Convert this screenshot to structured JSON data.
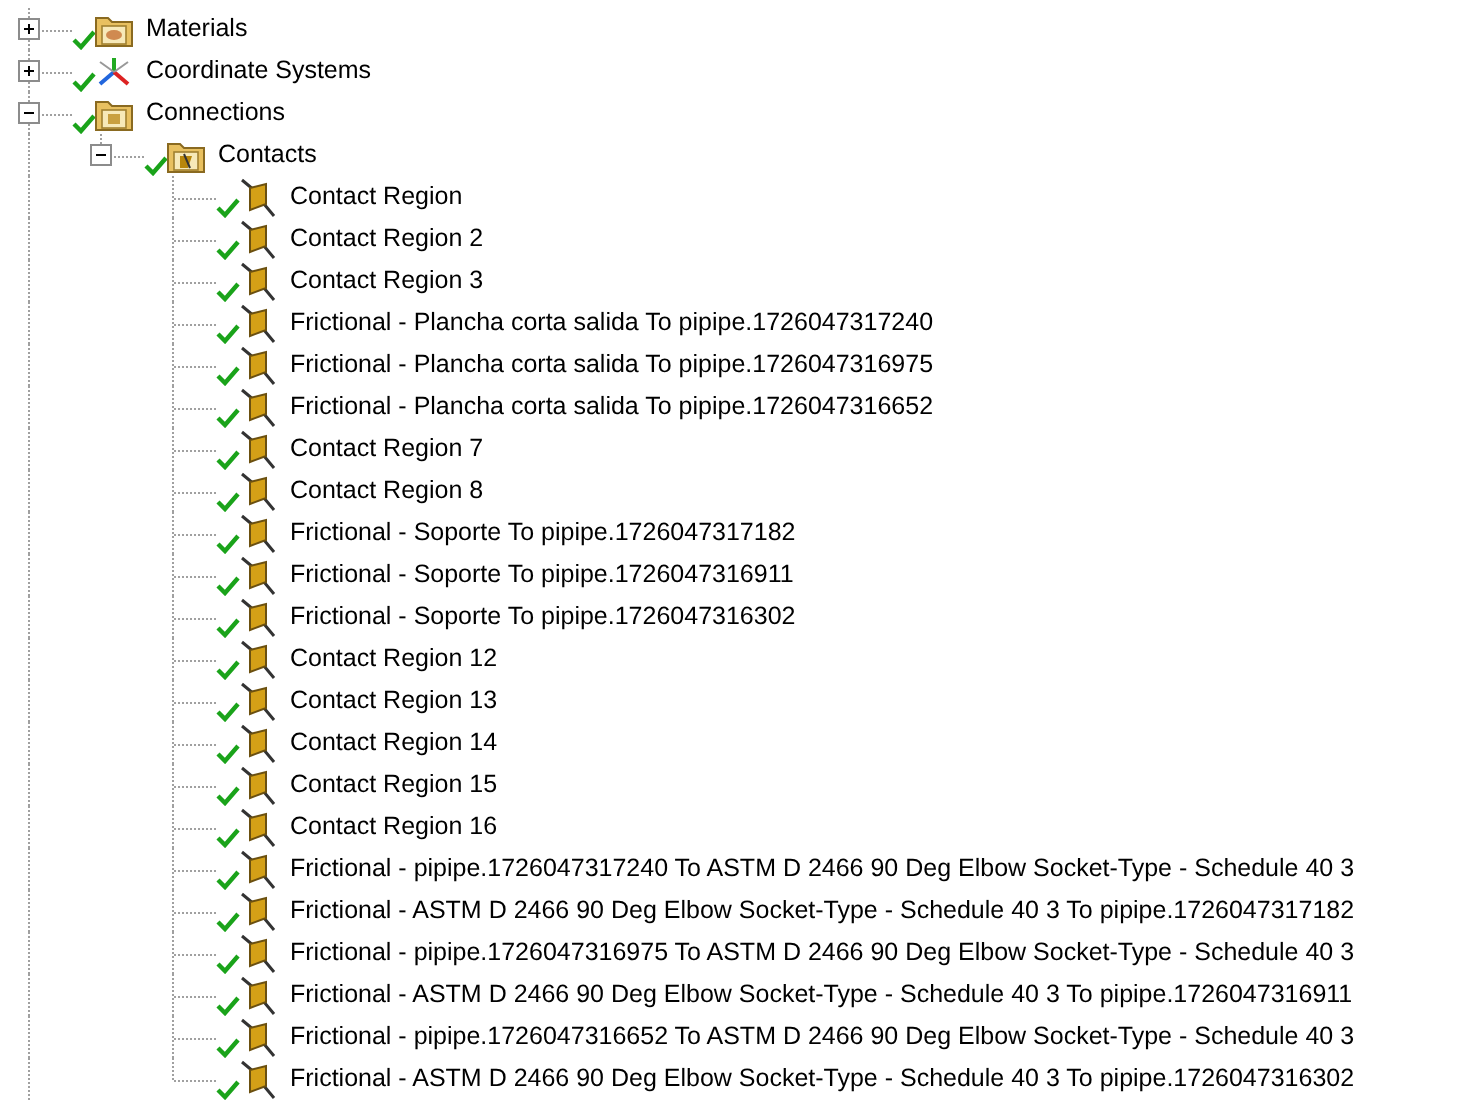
{
  "tree": [
    {
      "label": "Materials",
      "kind": "materials",
      "expanded": false
    },
    {
      "label": "Coordinate Systems",
      "kind": "coordinates",
      "expanded": false
    },
    {
      "label": "Connections",
      "kind": "connections",
      "expanded": true,
      "children": [
        {
          "label": "Contacts",
          "kind": "contacts",
          "expanded": true,
          "children": [
            {
              "label": "Contact Region",
              "kind": "contact"
            },
            {
              "label": "Contact Region 2",
              "kind": "contact"
            },
            {
              "label": "Contact Region 3",
              "kind": "contact"
            },
            {
              "label": "Frictional - Plancha corta salida To pipipe.1726047317240",
              "kind": "contact"
            },
            {
              "label": "Frictional - Plancha corta salida To pipipe.1726047316975",
              "kind": "contact"
            },
            {
              "label": "Frictional - Plancha corta salida To pipipe.1726047316652",
              "kind": "contact"
            },
            {
              "label": "Contact Region 7",
              "kind": "contact"
            },
            {
              "label": "Contact Region 8",
              "kind": "contact"
            },
            {
              "label": "Frictional - Soporte To pipipe.1726047317182",
              "kind": "contact"
            },
            {
              "label": "Frictional - Soporte To pipipe.1726047316911",
              "kind": "contact"
            },
            {
              "label": "Frictional - Soporte To pipipe.1726047316302",
              "kind": "contact"
            },
            {
              "label": "Contact Region 12",
              "kind": "contact"
            },
            {
              "label": "Contact Region 13",
              "kind": "contact"
            },
            {
              "label": "Contact Region 14",
              "kind": "contact"
            },
            {
              "label": "Contact Region 15",
              "kind": "contact"
            },
            {
              "label": "Contact Region 16",
              "kind": "contact"
            },
            {
              "label": "Frictional - pipipe.1726047317240 To ASTM D 2466 90 Deg Elbow Socket-Type - Schedule 40 3",
              "kind": "contact"
            },
            {
              "label": "Frictional - ASTM D 2466 90 Deg Elbow Socket-Type - Schedule 40 3 To pipipe.1726047317182",
              "kind": "contact"
            },
            {
              "label": "Frictional - pipipe.1726047316975 To ASTM D 2466 90 Deg Elbow Socket-Type - Schedule 40 3",
              "kind": "contact"
            },
            {
              "label": "Frictional - ASTM D 2466 90 Deg Elbow Socket-Type - Schedule 40 3 To pipipe.1726047316911",
              "kind": "contact"
            },
            {
              "label": "Frictional - pipipe.1726047316652 To ASTM D 2466 90 Deg Elbow Socket-Type - Schedule 40 3",
              "kind": "contact"
            },
            {
              "label": "Frictional - ASTM D 2466 90 Deg Elbow Socket-Type - Schedule 40 3 To pipipe.1726047316302",
              "kind": "contact"
            }
          ]
        }
      ]
    }
  ]
}
